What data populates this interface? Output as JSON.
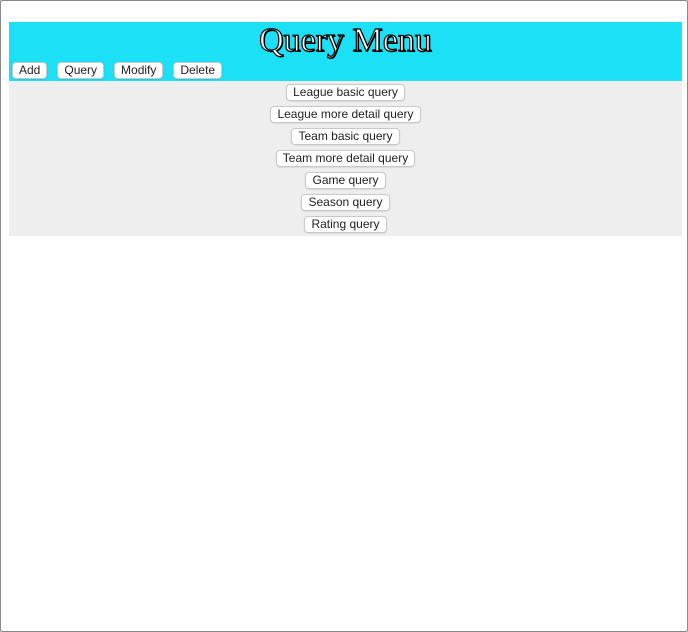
{
  "header": {
    "title": "Query Menu",
    "nav": [
      "Add",
      "Query",
      "Modify",
      "Delete"
    ]
  },
  "submenu": {
    "items": [
      "League basic query",
      "League more detail query",
      "Team basic query",
      "Team more detail query",
      "Game query",
      "Season query",
      "Rating query"
    ]
  },
  "colors": {
    "header_bg": "#1be0f6",
    "submenu_bg": "#eeeeee"
  }
}
